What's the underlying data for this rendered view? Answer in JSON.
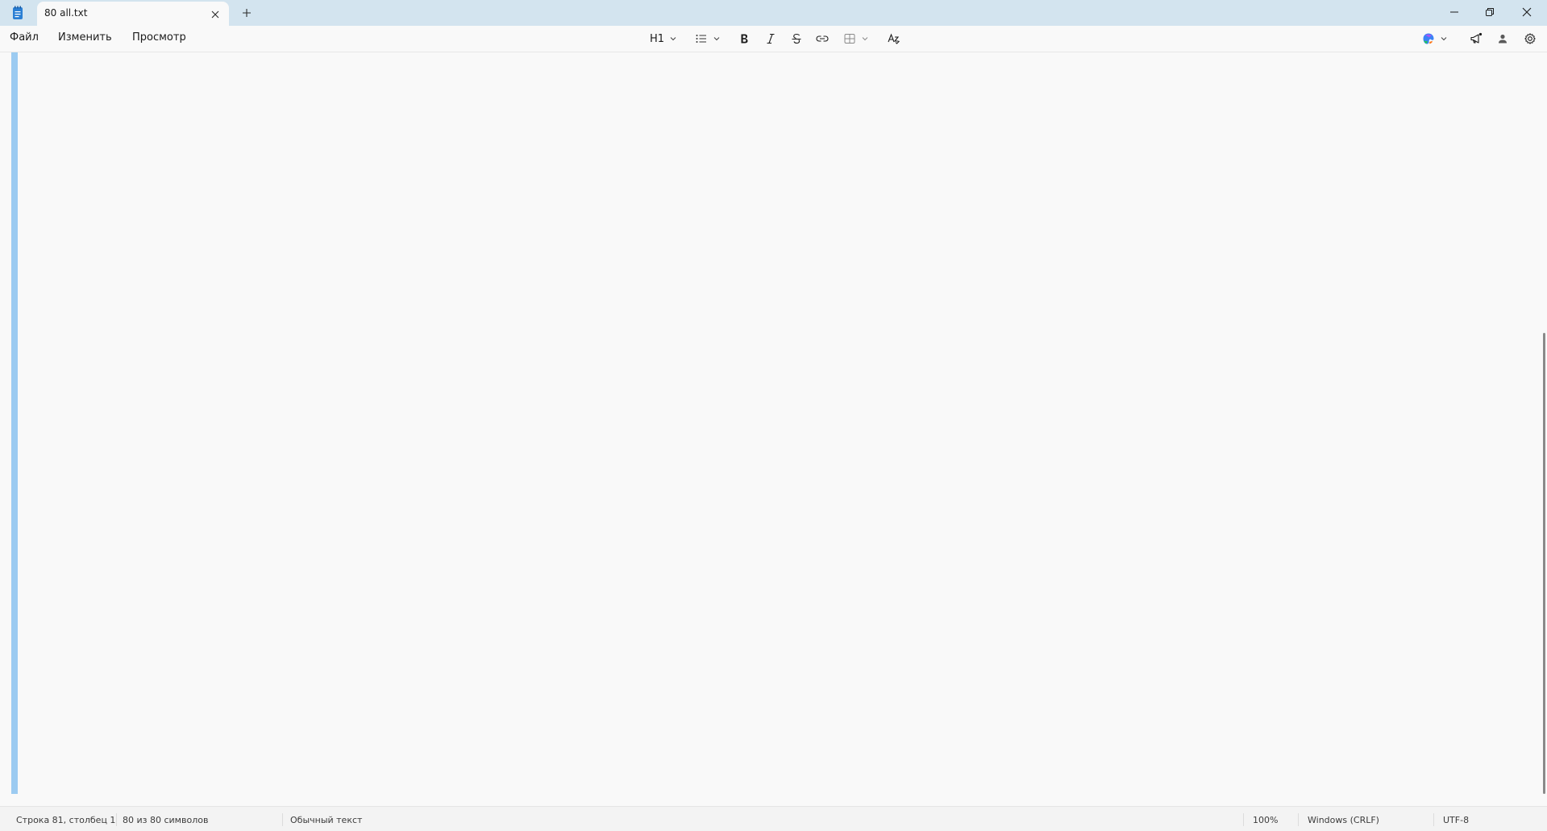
{
  "tab": {
    "title": "80 all.txt"
  },
  "menu": {
    "file": "Файл",
    "edit": "Изменить",
    "view": "Просмотр"
  },
  "toolbar": {
    "heading_label": "H1",
    "icons": {
      "list": "bulleted-list-icon",
      "bold": "bold-icon",
      "italic": "italic-icon",
      "strikethrough": "strikethrough-icon",
      "link": "link-icon",
      "table": "table-icon",
      "clear_formatting": "clear-formatting-icon",
      "copilot": "copilot-icon",
      "whats_new": "megaphone-icon",
      "account": "account-icon",
      "settings": "gear-icon"
    }
  },
  "status": {
    "position": "Строка 81, столбец 1",
    "char_count": "80 из 80 символов",
    "format": "Обычный текст",
    "zoom": "100%",
    "line_ending": "Windows (CRLF)",
    "encoding": "UTF-8"
  },
  "colors": {
    "titlebar": "#d3e4ef",
    "selection": "#9ccbf1",
    "accent": "#1f6fb8"
  }
}
